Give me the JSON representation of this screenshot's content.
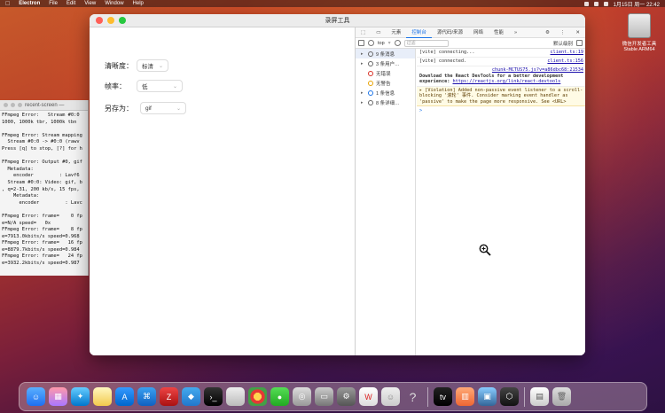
{
  "menubar": {
    "app": "Electron",
    "items": [
      "File",
      "Edit",
      "View",
      "Window",
      "Help"
    ],
    "datetime": "1月15日 周一 22:42"
  },
  "desktop": {
    "hd_label_line1": "微信开发者工具",
    "hd_label_line2": "Stable ARM64"
  },
  "terminal": {
    "title": "recent-screen — ",
    "lines": [
      "FFmpeg Error:   Stream #0:0",
      "1000, 1000k tbr, 1000k tbn",
      "",
      "FFmpeg Error: Stream mapping",
      "  Stream #0:0 -> #0:0 (rawv",
      "Press [q] to stop, [?] for h",
      "",
      "FFmpeg Error: Output #0, gif",
      "  Metadata:",
      "    encoder         : Lavf6",
      "  Stream #0:0: Video: gif, b",
      ", q=2-31, 200 kb/s, 15 fps,",
      "    Metadata:",
      "      encoder         : Lavc",
      "",
      "FFmpeg Error: frame=    0 fp",
      "e=N/A speed=   0x",
      "FFmpeg Error: frame=    8 fp",
      "e=7913.0kbits/s speed=0.968",
      "FFmpeg Error: frame=   16 fp",
      "e=8879.7kbits/s speed=0.984",
      "FFmpeg Error: frame=   24 fp",
      "e=3932.2kbits/s speed=0.987",
      ""
    ]
  },
  "window": {
    "title": "录屏工具"
  },
  "form": {
    "clarity_label": "清晰度：",
    "clarity_value": "标清",
    "fps_label": "帧率：",
    "fps_value": "低",
    "save_label": "另存为：",
    "save_value": "gif"
  },
  "devtools": {
    "tabs": [
      "元素",
      "控制台",
      "源代码/来源",
      "网络",
      "性能",
      "»"
    ],
    "active_tab": "控制台",
    "context": "top",
    "filter_placeholder": "过滤",
    "level": "默认级别",
    "sidebar": [
      {
        "arrow": "▸",
        "icon": "list-icon",
        "label": "9 条消息",
        "kind": "list"
      },
      {
        "arrow": "▸",
        "icon": "user-icon",
        "label": "3 条用户…",
        "kind": "user"
      },
      {
        "arrow": "",
        "icon": "error-icon",
        "label": "无错误",
        "kind": "err"
      },
      {
        "arrow": "",
        "icon": "warning-icon",
        "label": "无警告",
        "kind": "warn"
      },
      {
        "arrow": "▸",
        "icon": "info-icon",
        "label": "1 条信息",
        "kind": "info"
      },
      {
        "arrow": "▸",
        "icon": "verbose-icon",
        "label": "8 条详细…",
        "kind": "verbose"
      }
    ],
    "console": {
      "line1_text": "[vite] connecting...",
      "line1_src": "client.ts:19",
      "line2_text": "[vite] connected.",
      "line2_src": "client.ts:156",
      "line3_src": "chunk-MCTUS75.js?v=a86dbc68:21534",
      "line3_text": "Download the React DevTools for a better development experience: ",
      "line3_link": "https://reactjs.org/link/react-devtools",
      "warn_text": "[Violation] Added non-passive event listener to a scroll-blocking '滚轮' 事件. Consider marking event handler as 'passive' to make the page more responsive. See <URL>",
      "prompt": ">"
    }
  }
}
